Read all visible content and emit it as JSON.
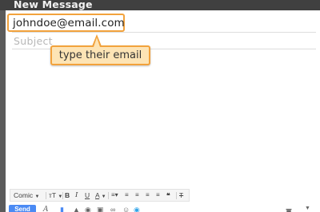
{
  "window": {
    "title": "New Message"
  },
  "compose": {
    "to_value": "johndoe@email.com",
    "subject_placeholder": "Subject"
  },
  "callout": {
    "text": "type their email",
    "color": "#f2a23c",
    "fill": "#fde4b5"
  },
  "toolbar": {
    "font_label": "Comic",
    "size_label": "тT",
    "bold_label": "B",
    "italic_label": "I",
    "underline_label": "U",
    "text_color_label": "A",
    "send_label": "Send"
  },
  "colors": {
    "titlebar": "#404040",
    "send": "#4a8af4",
    "accent": "#f2a23c"
  }
}
